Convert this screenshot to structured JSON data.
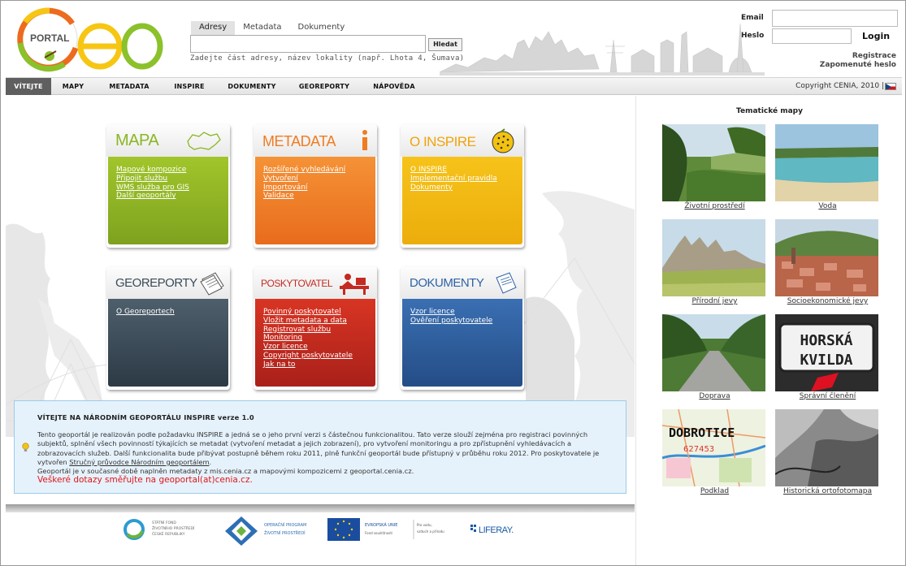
{
  "header": {
    "logo_text": "PORTAL",
    "search_tabs": [
      "Adresy",
      "Metadata",
      "Dokumenty"
    ],
    "search_value": "",
    "search_button": "Hledat",
    "search_hint": "Zadejte část adresy, název lokality (např. Lhota 4, Šumava)",
    "email_label": "Email",
    "password_label": "Heslo",
    "login_label": "Login",
    "register_link": "Registrace",
    "forgot_link": "Zapomenuté heslo"
  },
  "nav": {
    "items": [
      "VÍTEJTE",
      "MAPY",
      "METADATA",
      "INSPIRE",
      "DOKUMENTY",
      "GEOREPORTY",
      "NÁPOVĚDA"
    ],
    "active": "VÍTEJTE",
    "copyright": "Copyright CENIA, 2010 |"
  },
  "tiles": [
    {
      "title": "MAPA",
      "links": [
        "Mapové kompozice",
        "Připojit službu",
        "WMS služba pro GIS",
        "Další geoportály"
      ]
    },
    {
      "title": "METADATA",
      "links": [
        "Rozšířené vyhledávání",
        "Vytvoření",
        "Importování",
        "Validace"
      ]
    },
    {
      "title": "O INSPIRE",
      "links": [
        "O INSPIRE",
        "Implementační pravidla",
        "Dokumenty"
      ]
    },
    {
      "title": "GEOREPORTY",
      "links": [
        "O Georeportech"
      ]
    },
    {
      "title": "POSKYTOVATEL",
      "links": [
        "Povinný poskytovatel",
        "Vložit metadata a data",
        "Registrovat službu",
        "Monitoring",
        "Vzor licence",
        "Copyright poskytovatele",
        "Jak na to"
      ]
    },
    {
      "title": "DOKUMENTY",
      "links": [
        "Vzor licence",
        "Ověření poskytovatele"
      ]
    }
  ],
  "welcome": {
    "title": "VÍTEJTE NA NÁRODNÍM GEOPORTÁLU INSPIRE verze 1.0",
    "text_a": "Tento geoportál je realizován podle požadavku INSPIRE a jedná se o jeho první verzi s částečnou funkcionalitou. Tato verze slouží zejména pro registraci povinných subjektů, splnění všech povinností týkajících se metadat (vytvoření metadat a jejich zobrazení), pro vytvoření monitoringu a pro zpřístupnění vyhledávacích a zobrazovacích služeb. Další funkcionalita bude přibývat postupně během roku 2011, plně funkční geoportál bude přístupný v průběhu roku 2012. Pro poskytovatele je vytvořen ",
    "text_link": "Stručný průvodce Národním geoportálem",
    "text_b": ".",
    "text_c": "Geoportál je v současné době naplněn metadaty z mis.cenia.cz a mapovými kompozicemi z geoportal.cenia.cz.",
    "contact": "Veškeré dotazy směřujte na geoportal(at)cenia.cz."
  },
  "footer_logos": {
    "sfzp": [
      "STÁTNÍ FOND",
      "ŽIVOTNÍHO PROSTŘEDÍ",
      "ČESKÉ REPUBLIKY"
    ],
    "opzp": [
      "OPERAČNÍ PROGRAM",
      "ŽIVOTNÍ PROSTŘEDÍ"
    ],
    "eu": [
      "EVROPSKÁ UNIE",
      "Fond soudržnosti",
      "Pro vodu,",
      "vzduch a přírodu"
    ],
    "liferay": "LIFERAY."
  },
  "thematic": {
    "title": "Tematické mapy",
    "items": [
      "Životní prostředí",
      "Voda",
      "Přírodní jevy",
      "Socioekonomické jevy",
      "Doprava",
      "Správní členění",
      "Podklad",
      "Historická ortofotomapa"
    ],
    "sign_text": [
      "HORSKÁ",
      "KVILDA"
    ],
    "map_text": [
      "DOBROTICE",
      "627453"
    ]
  },
  "colors": {
    "mapa": "#8bb623",
    "metadata": "#ef7c22",
    "inspire": "#f3bb12",
    "georeporty": "#3d4d5a",
    "poskytovatel": "#c42a22",
    "dokumenty": "#2e5e9c",
    "contact": "#e0141a"
  }
}
